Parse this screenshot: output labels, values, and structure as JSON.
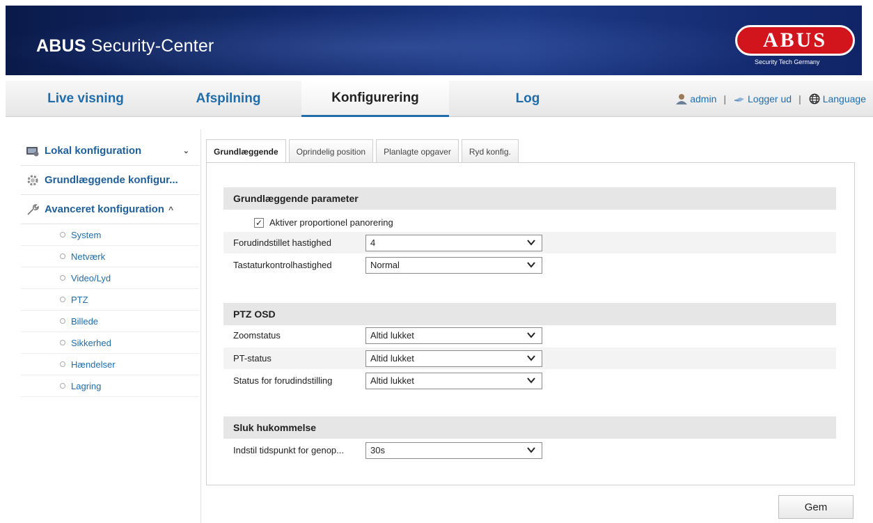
{
  "header": {
    "title_bold": "ABUS",
    "title_rest": " Security-Center",
    "logo_text": "ABUS",
    "logo_tagline": "Security Tech Germany"
  },
  "nav": {
    "items": [
      {
        "label": "Live visning"
      },
      {
        "label": "Afspilning"
      },
      {
        "label": "Konfigurering",
        "active": true
      },
      {
        "label": "Log"
      }
    ],
    "user": "admin",
    "logout": "Logger ud",
    "language": "Language",
    "separator": "|"
  },
  "sidebar": {
    "groups": [
      {
        "label": "Lokal konfiguration",
        "chevron": "⌄",
        "icon": "monitor-icon"
      },
      {
        "label": "Grundlæggende konfigur...",
        "icon": "gear-icon"
      },
      {
        "label": "Avanceret konfiguration",
        "chevron": "^",
        "icon": "wrench-icon"
      }
    ],
    "subitems": [
      "System",
      "Netværk",
      "Video/Lyd",
      "PTZ",
      "Billede",
      "Sikkerhed",
      "Hændelser",
      "Lagring"
    ]
  },
  "tabs": [
    {
      "label": "Grundlæggende",
      "active": true
    },
    {
      "label": "Oprindelig position"
    },
    {
      "label": "Planlagte opgaver"
    },
    {
      "label": "Ryd konfig."
    }
  ],
  "sections": {
    "basic": {
      "title": "Grundlæggende parameter",
      "checkbox_label": "Aktiver proportionel panorering",
      "checkbox_checked": true,
      "preset_speed_label": "Forudindstillet hastighed",
      "preset_speed_value": "4",
      "keyboard_speed_label": "Tastaturkontrolhastighed",
      "keyboard_speed_value": "Normal"
    },
    "osd": {
      "title": "PTZ OSD",
      "zoom_label": "Zoomstatus",
      "zoom_value": "Altid lukket",
      "pt_label": "PT-status",
      "pt_value": "Altid lukket",
      "preset_status_label": "Status for forudindstilling",
      "preset_status_value": "Altid lukket"
    },
    "memory": {
      "title": "Sluk hukommelse",
      "resume_label": "Indstil tidspunkt for genop...",
      "resume_value": "30s"
    }
  },
  "save_label": "Gem",
  "colors": {
    "link": "#1f6dab",
    "banner": "#142c6e",
    "logo_red": "#d2141c"
  }
}
